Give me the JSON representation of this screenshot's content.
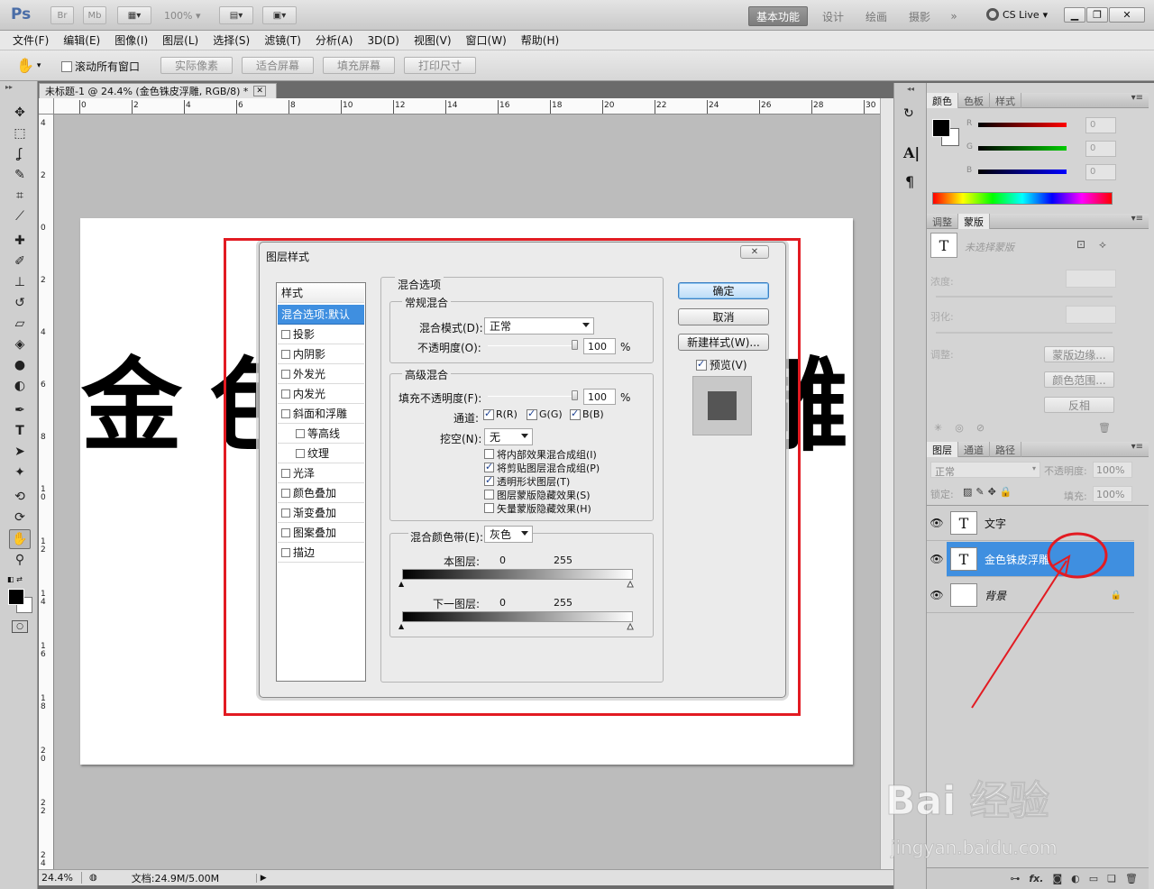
{
  "app": {
    "logo": "Ps",
    "bridge": "Br",
    "minibridge": "Mb",
    "zoom": "100%",
    "cs_live": "CS Live"
  },
  "workspaces": [
    "基本功能",
    "设计",
    "绘画",
    "摄影",
    "»"
  ],
  "menu": [
    "文件(F)",
    "编辑(E)",
    "图像(I)",
    "图层(L)",
    "选择(S)",
    "滤镜(T)",
    "分析(A)",
    "3D(D)",
    "视图(V)",
    "窗口(W)",
    "帮助(H)"
  ],
  "options": {
    "scroll_all": "滚动所有窗口",
    "actual_pixels": "实际像素",
    "fit_screen": "适合屏幕",
    "fill_screen": "填充屏幕",
    "print_size": "打印尺寸"
  },
  "document": {
    "tab_title": "未标题-1 @ 24.4% (金色铢皮浮雕, RGB/8) *",
    "close": "✕",
    "hruler": [
      "0",
      "2",
      "4",
      "6",
      "8",
      "10",
      "12",
      "14",
      "16",
      "18",
      "20",
      "22",
      "24",
      "26",
      "28",
      "30"
    ],
    "vruler": [
      "4",
      "2",
      "0",
      "2",
      "4",
      "6",
      "8",
      "1 0",
      "1 2",
      "1 4",
      "1 6",
      "1 8",
      "2 0",
      "2 2",
      "2 4"
    ],
    "canvas_chars": [
      "金",
      "色",
      "雕"
    ],
    "status_zoom": "24.4%",
    "status_doc": "文档:24.9M/5.00M"
  },
  "dialog": {
    "title": "图层样式",
    "close": "✕",
    "styles_header": "样式",
    "style_items": [
      {
        "label": "混合选项:默认",
        "checkbox": false
      },
      {
        "label": "投影",
        "checkbox": true
      },
      {
        "label": "内阴影",
        "checkbox": true
      },
      {
        "label": "外发光",
        "checkbox": true
      },
      {
        "label": "内发光",
        "checkbox": true
      },
      {
        "label": "斜面和浮雕",
        "checkbox": true
      },
      {
        "label": "等高线",
        "checkbox": true
      },
      {
        "label": "纹理",
        "checkbox": true
      },
      {
        "label": "光泽",
        "checkbox": true
      },
      {
        "label": "颜色叠加",
        "checkbox": true
      },
      {
        "label": "渐变叠加",
        "checkbox": true
      },
      {
        "label": "图案叠加",
        "checkbox": true
      },
      {
        "label": "描边",
        "checkbox": true
      }
    ],
    "blend_options": "混合选项",
    "general_blending": "常规混合",
    "blend_mode_label": "混合模式(D):",
    "blend_mode_value": "正常",
    "opacity_label": "不透明度(O):",
    "opacity_value": "100",
    "percent": "%",
    "advanced_blending": "高级混合",
    "fill_opacity_label": "填充不透明度(F):",
    "fill_opacity_value": "100",
    "channels_label": "通道:",
    "channel_r": "R(R)",
    "channel_g": "G(G)",
    "channel_b": "B(B)",
    "knockout_label": "挖空(N):",
    "knockout_value": "无",
    "checks": [
      {
        "label": "将内部效果混合成组(I)",
        "checked": false
      },
      {
        "label": "将剪贴图层混合成组(P)",
        "checked": true
      },
      {
        "label": "透明形状图层(T)",
        "checked": true
      },
      {
        "label": "图层蒙版隐藏效果(S)",
        "checked": false
      },
      {
        "label": "矢量蒙版隐藏效果(H)",
        "checked": false
      }
    ],
    "blend_if_label": "混合颜色带(E):",
    "blend_if_value": "灰色",
    "this_layer": "本图层:",
    "underlying": "下一图层:",
    "range_min": "0",
    "range_max": "255",
    "ok": "确定",
    "cancel": "取消",
    "new_style": "新建样式(W)...",
    "preview": "预览(V)"
  },
  "color_panel": {
    "tabs": [
      "颜色",
      "色板",
      "样式"
    ],
    "r": "R",
    "g": "G",
    "b": "B",
    "r_value": "0",
    "g_value": "0",
    "b_value": "0"
  },
  "mask_panel": {
    "tabs": [
      "调整",
      "蒙版"
    ],
    "no_mask": "未选择蒙版",
    "density": "浓度:",
    "feather": "羽化:",
    "refine": "调整:",
    "mask_edge": "蒙版边缘...",
    "color_range": "颜色范围...",
    "invert": "反相"
  },
  "layers_panel": {
    "tabs": [
      "图层",
      "通道",
      "路径"
    ],
    "blend_mode": "正常",
    "opacity_label": "不透明度:",
    "opacity_value": "100%",
    "lock_label": "锁定:",
    "fill_label": "填充:",
    "fill_value": "100%",
    "layers": [
      {
        "name": "文字",
        "type": "text",
        "selected": false
      },
      {
        "name": "金色铢皮浮雕",
        "type": "text",
        "selected": true
      },
      {
        "name": "背景",
        "type": "image",
        "selected": false
      }
    ]
  },
  "watermark": {
    "brand": "Bai 经验",
    "url": "jingyan.baidu.com"
  },
  "colors": {
    "accent_selected": "#3f8fe0",
    "annotation_red": "#e21b22"
  }
}
